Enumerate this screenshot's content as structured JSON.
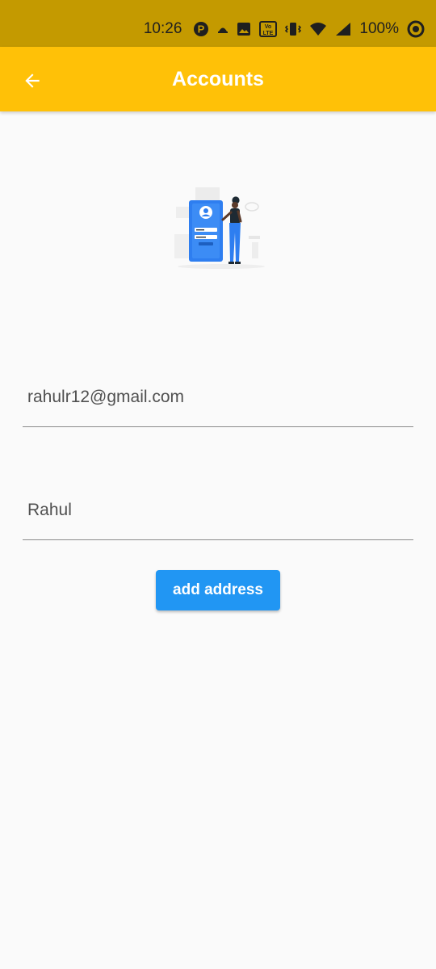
{
  "status_bar": {
    "time": "10:26",
    "battery": "100%",
    "icons": [
      "p-app-icon",
      "notification-icon",
      "image-icon",
      "volte-icon",
      "vibrate-icon",
      "wifi-icon",
      "signal-icon",
      "battery-icon"
    ],
    "volte_label": "Vo LTE"
  },
  "app_bar": {
    "title": "Accounts",
    "back_icon": "arrow-left-icon",
    "color": "#ffc107"
  },
  "illustration": {
    "icon": "login-illustration"
  },
  "form": {
    "email_value": "rahulr12@gmail.com",
    "name_value": "Rahul"
  },
  "actions": {
    "add_address_label": "add address",
    "button_color": "#2196f3"
  }
}
